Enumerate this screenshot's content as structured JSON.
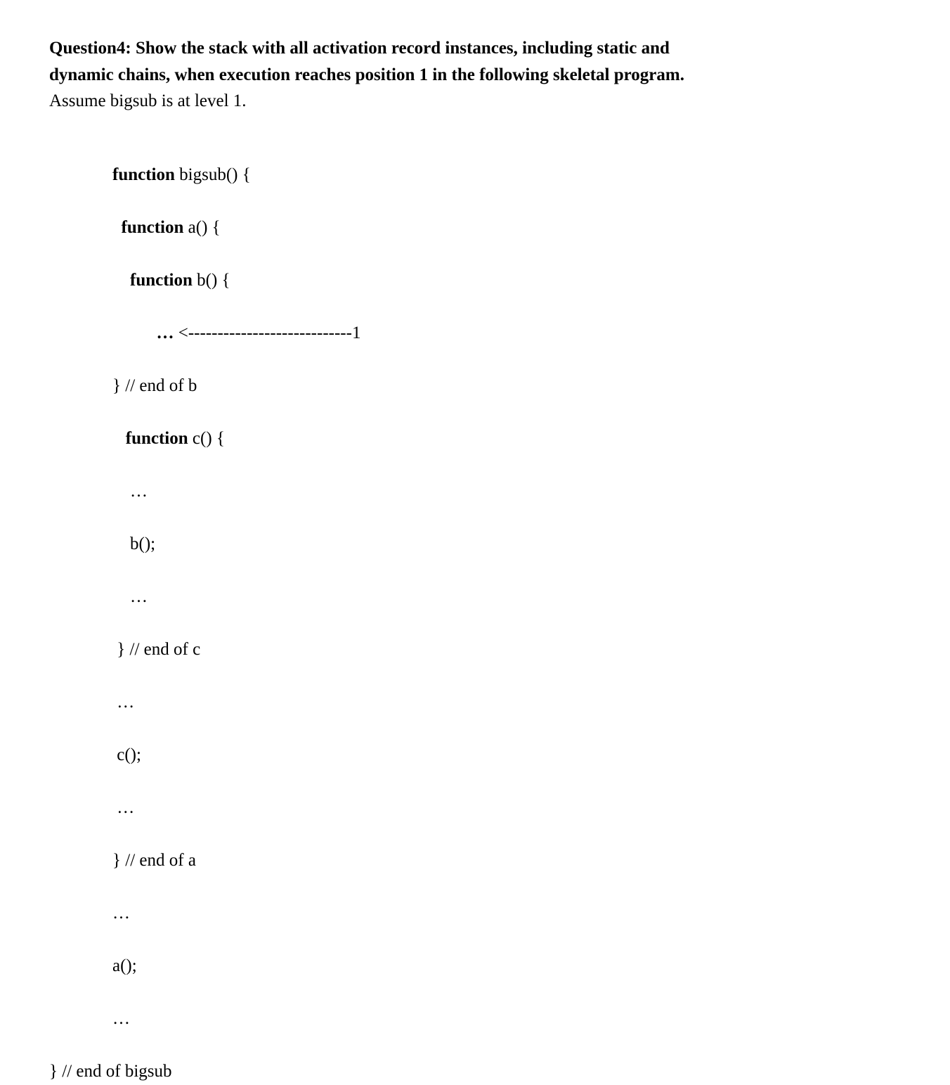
{
  "header": {
    "question_label": "Question4:",
    "question_text_1": " Show the stack with all activation record instances, including static and",
    "question_text_2": "dynamic chains, when execution reaches position 1 in the following skeletal program.",
    "assumption": "Assume bigsub is at level 1."
  },
  "code": {
    "line1_kw": "function",
    "line1_rest": " bigsub() {",
    "line2_kw": "function",
    "line2_rest": " a() {",
    "line3_kw": "function",
    "line3_rest": " b() {",
    "line4_bold": "…",
    "line4_arrow": " <----------------------------1",
    "line5": "} // end of b",
    "line6_kw": "function",
    "line6_rest": " c() {",
    "line7": "…",
    "line8": "b();",
    "line9": "…",
    "line10": " } // end of c",
    "line11": " …",
    "line12": " c();",
    "line13": " …",
    "line14": "} // end of a",
    "line15": "…",
    "line16": "a();",
    "line17": "…",
    "end_bigsub_close": "} ",
    "end_bigsub_comment": "// end of bigsub"
  }
}
